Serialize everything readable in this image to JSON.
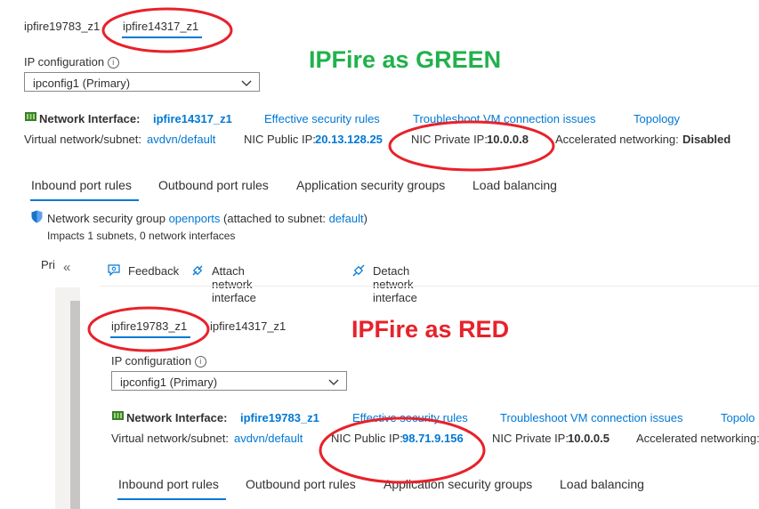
{
  "top": {
    "nic_tabs": [
      "ipfire19783_z1",
      "ipfire14317_z1"
    ],
    "ipconfig_label": "IP configuration",
    "ipconfig_value": "ipconfig1 (Primary)",
    "ni_label": "Network Interface:",
    "ni_name": "ipfire14317_z1",
    "links": [
      "Effective security rules",
      "Troubleshoot VM connection issues",
      "Topology"
    ],
    "vnet_label": "Virtual network/subnet:",
    "vnet_value": "avdvn/default",
    "public_ip_label": "NIC Public IP:",
    "public_ip_value": "20.13.128.25",
    "private_ip_label": "NIC Private IP:",
    "private_ip_value": "10.0.0.8",
    "accel_label": "Accelerated networking:",
    "accel_value": "Disabled",
    "port_tabs": [
      "Inbound port rules",
      "Outbound port rules",
      "Application security groups",
      "Load balancing"
    ],
    "nsg_text_1": "Network security group",
    "nsg_name": "openports",
    "nsg_text_2": "(attached to subnet:",
    "nsg_subnet": "default",
    "nsg_text_3": ")",
    "impacts": "Impacts 1 subnets, 0 network interfaces"
  },
  "annotation_green": "IPFire as GREEN",
  "annotation_red": "IPFire as RED",
  "side": {
    "label_partial": "Pri",
    "collapse_glyph": "«"
  },
  "toolbar": {
    "feedback": "Feedback",
    "attach": "Attach network interface",
    "detach": "Detach network interface"
  },
  "bottom": {
    "nic_tabs": [
      "ipfire19783_z1",
      "ipfire14317_z1"
    ],
    "ipconfig_label": "IP configuration",
    "ipconfig_value": "ipconfig1 (Primary)",
    "ni_label": "Network Interface:",
    "ni_name": "ipfire19783_z1",
    "links": [
      "Effective security rules",
      "Troubleshoot VM connection issues",
      "Topolo"
    ],
    "vnet_label": "Virtual network/subnet:",
    "vnet_value": "avdvn/default",
    "public_ip_label": "NIC Public IP:",
    "public_ip_value": "98.71.9.156",
    "private_ip_label": "NIC Private IP:",
    "private_ip_value": "10.0.0.5",
    "accel_label": "Accelerated networking:",
    "port_tabs": [
      "Inbound port rules",
      "Outbound port rules",
      "Application security groups",
      "Load balancing"
    ]
  },
  "colors": {
    "link": "#0078d4",
    "annotation_green": "#22b14c",
    "annotation_red": "#e8212a"
  }
}
